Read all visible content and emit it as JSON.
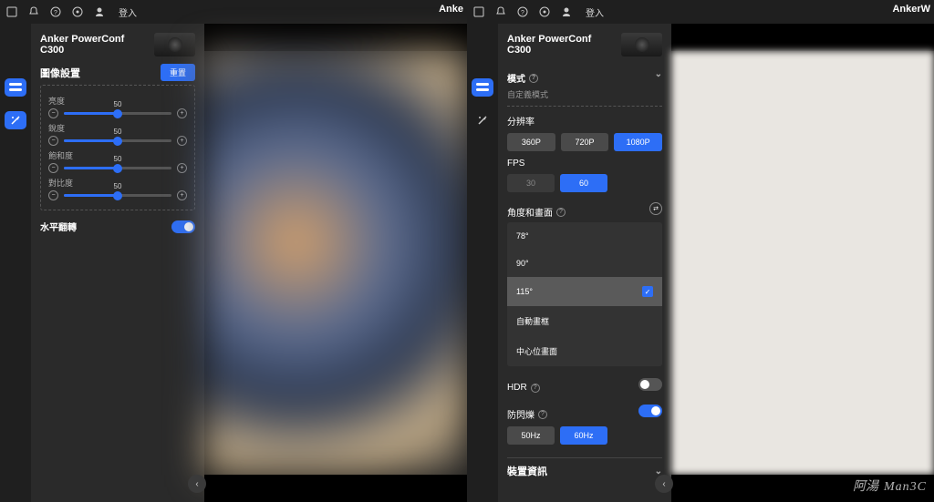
{
  "brand_left": "Anke",
  "brand_right": "AnkerW",
  "login": "登入",
  "device": "Anker PowerConf C300",
  "left": {
    "section_title": "圖像設置",
    "reset": "重置",
    "sliders": [
      {
        "label": "亮度",
        "value": 50,
        "min": 0,
        "max": 100
      },
      {
        "label": "銳度",
        "value": 50,
        "min": 0,
        "max": 100
      },
      {
        "label": "飽和度",
        "value": 50,
        "min": 0,
        "max": 100
      },
      {
        "label": "對比度",
        "value": 50,
        "min": 0,
        "max": 100
      }
    ],
    "flip_label": "水平翻轉",
    "flip_on": true
  },
  "right": {
    "mode_h": "模式",
    "mode_sub": "自定義模式",
    "res_label": "分辨率",
    "res_opts": [
      "360P",
      "720P",
      "1080P"
    ],
    "res_sel": "1080P",
    "fps_label": "FPS",
    "fps_opts": [
      "30",
      "60"
    ],
    "fps_sel": "60",
    "angle_label": "角度和畫面",
    "angle_opts": [
      "78°",
      "90°",
      "115°",
      "自動畫框",
      "中心位畫面"
    ],
    "angle_sel": "115°",
    "hdr_label": "HDR",
    "hdr_on": false,
    "flicker_label": "防閃爍",
    "flicker_on": true,
    "hz_opts": [
      "50Hz",
      "60Hz"
    ],
    "hz_sel": "60Hz",
    "info_h": "裝置資訊"
  },
  "watermark_a": "阿湯",
  "watermark_b": "Man3C"
}
